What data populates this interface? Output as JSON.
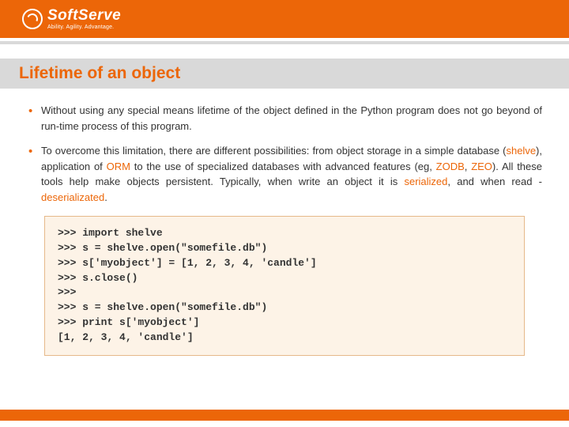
{
  "brand": {
    "name": "SoftServe",
    "tagline": "Ability. Agility. Advantage."
  },
  "title": "Lifetime of an object",
  "bullets": [
    {
      "pre": "Without using any special means lifetime of the object defined in the Python program does not go beyond of run-time process of this program."
    },
    {
      "seg1": "To overcome this limitation, there are different possibilities: from object storage in a simple database (",
      "hl1": "shelve",
      "seg2": "), application of ",
      "hl2": "ORM",
      "seg3": " to the use of specialized databases with advanced features (eg, ",
      "hl3": "ZODB",
      "seg4": ", ",
      "hl4": "ZEO",
      "seg5": "). All these tools help make objects persistent. Typically, when write an object it is ",
      "hl5": "serialized",
      "seg6": ", and when read - ",
      "hl6": "deserializated",
      "seg7": "."
    }
  ],
  "code": ">>> import shelve\n>>> s = shelve.open(\"somefile.db\")\n>>> s['myobject'] = [1, 2, 3, 4, 'candle']\n>>> s.close()\n>>>\n>>> s = shelve.open(\"somefile.db\")\n>>> print s['myobject']\n[1, 2, 3, 4, 'candle']"
}
